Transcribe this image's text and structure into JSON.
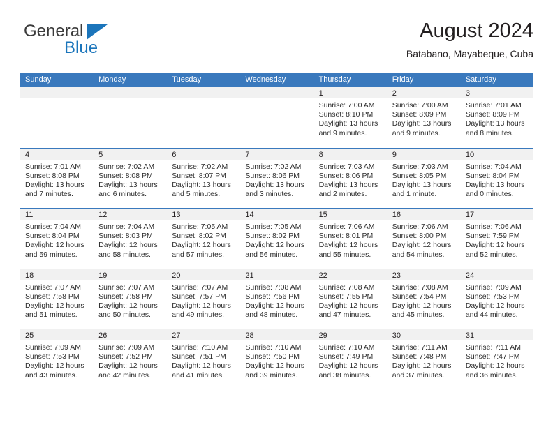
{
  "brand": {
    "line1": "General",
    "line2": "Blue",
    "triangle_color": "#1b75bb"
  },
  "header": {
    "title": "August 2024",
    "subtitle": "Batabano, Mayabeque, Cuba"
  },
  "theme": {
    "header_bar": "#3a79bd",
    "date_strip": "#f1f1f1",
    "text": "#231f20"
  },
  "weekdays": [
    "Sunday",
    "Monday",
    "Tuesday",
    "Wednesday",
    "Thursday",
    "Friday",
    "Saturday"
  ],
  "weeks": [
    [
      {
        "date": "",
        "sunrise": "",
        "sunset": "",
        "daylight": "",
        "empty": true
      },
      {
        "date": "",
        "sunrise": "",
        "sunset": "",
        "daylight": "",
        "empty": true
      },
      {
        "date": "",
        "sunrise": "",
        "sunset": "",
        "daylight": "",
        "empty": true
      },
      {
        "date": "",
        "sunrise": "",
        "sunset": "",
        "daylight": "",
        "empty": true
      },
      {
        "date": "1",
        "sunrise": "Sunrise: 7:00 AM",
        "sunset": "Sunset: 8:10 PM",
        "daylight": "Daylight: 13 hours and 9 minutes."
      },
      {
        "date": "2",
        "sunrise": "Sunrise: 7:00 AM",
        "sunset": "Sunset: 8:09 PM",
        "daylight": "Daylight: 13 hours and 9 minutes."
      },
      {
        "date": "3",
        "sunrise": "Sunrise: 7:01 AM",
        "sunset": "Sunset: 8:09 PM",
        "daylight": "Daylight: 13 hours and 8 minutes."
      }
    ],
    [
      {
        "date": "4",
        "sunrise": "Sunrise: 7:01 AM",
        "sunset": "Sunset: 8:08 PM",
        "daylight": "Daylight: 13 hours and 7 minutes."
      },
      {
        "date": "5",
        "sunrise": "Sunrise: 7:02 AM",
        "sunset": "Sunset: 8:08 PM",
        "daylight": "Daylight: 13 hours and 6 minutes."
      },
      {
        "date": "6",
        "sunrise": "Sunrise: 7:02 AM",
        "sunset": "Sunset: 8:07 PM",
        "daylight": "Daylight: 13 hours and 5 minutes."
      },
      {
        "date": "7",
        "sunrise": "Sunrise: 7:02 AM",
        "sunset": "Sunset: 8:06 PM",
        "daylight": "Daylight: 13 hours and 3 minutes."
      },
      {
        "date": "8",
        "sunrise": "Sunrise: 7:03 AM",
        "sunset": "Sunset: 8:06 PM",
        "daylight": "Daylight: 13 hours and 2 minutes."
      },
      {
        "date": "9",
        "sunrise": "Sunrise: 7:03 AM",
        "sunset": "Sunset: 8:05 PM",
        "daylight": "Daylight: 13 hours and 1 minute."
      },
      {
        "date": "10",
        "sunrise": "Sunrise: 7:04 AM",
        "sunset": "Sunset: 8:04 PM",
        "daylight": "Daylight: 13 hours and 0 minutes."
      }
    ],
    [
      {
        "date": "11",
        "sunrise": "Sunrise: 7:04 AM",
        "sunset": "Sunset: 8:04 PM",
        "daylight": "Daylight: 12 hours and 59 minutes."
      },
      {
        "date": "12",
        "sunrise": "Sunrise: 7:04 AM",
        "sunset": "Sunset: 8:03 PM",
        "daylight": "Daylight: 12 hours and 58 minutes."
      },
      {
        "date": "13",
        "sunrise": "Sunrise: 7:05 AM",
        "sunset": "Sunset: 8:02 PM",
        "daylight": "Daylight: 12 hours and 57 minutes."
      },
      {
        "date": "14",
        "sunrise": "Sunrise: 7:05 AM",
        "sunset": "Sunset: 8:02 PM",
        "daylight": "Daylight: 12 hours and 56 minutes."
      },
      {
        "date": "15",
        "sunrise": "Sunrise: 7:06 AM",
        "sunset": "Sunset: 8:01 PM",
        "daylight": "Daylight: 12 hours and 55 minutes."
      },
      {
        "date": "16",
        "sunrise": "Sunrise: 7:06 AM",
        "sunset": "Sunset: 8:00 PM",
        "daylight": "Daylight: 12 hours and 54 minutes."
      },
      {
        "date": "17",
        "sunrise": "Sunrise: 7:06 AM",
        "sunset": "Sunset: 7:59 PM",
        "daylight": "Daylight: 12 hours and 52 minutes."
      }
    ],
    [
      {
        "date": "18",
        "sunrise": "Sunrise: 7:07 AM",
        "sunset": "Sunset: 7:58 PM",
        "daylight": "Daylight: 12 hours and 51 minutes."
      },
      {
        "date": "19",
        "sunrise": "Sunrise: 7:07 AM",
        "sunset": "Sunset: 7:58 PM",
        "daylight": "Daylight: 12 hours and 50 minutes."
      },
      {
        "date": "20",
        "sunrise": "Sunrise: 7:07 AM",
        "sunset": "Sunset: 7:57 PM",
        "daylight": "Daylight: 12 hours and 49 minutes."
      },
      {
        "date": "21",
        "sunrise": "Sunrise: 7:08 AM",
        "sunset": "Sunset: 7:56 PM",
        "daylight": "Daylight: 12 hours and 48 minutes."
      },
      {
        "date": "22",
        "sunrise": "Sunrise: 7:08 AM",
        "sunset": "Sunset: 7:55 PM",
        "daylight": "Daylight: 12 hours and 47 minutes."
      },
      {
        "date": "23",
        "sunrise": "Sunrise: 7:08 AM",
        "sunset": "Sunset: 7:54 PM",
        "daylight": "Daylight: 12 hours and 45 minutes."
      },
      {
        "date": "24",
        "sunrise": "Sunrise: 7:09 AM",
        "sunset": "Sunset: 7:53 PM",
        "daylight": "Daylight: 12 hours and 44 minutes."
      }
    ],
    [
      {
        "date": "25",
        "sunrise": "Sunrise: 7:09 AM",
        "sunset": "Sunset: 7:53 PM",
        "daylight": "Daylight: 12 hours and 43 minutes."
      },
      {
        "date": "26",
        "sunrise": "Sunrise: 7:09 AM",
        "sunset": "Sunset: 7:52 PM",
        "daylight": "Daylight: 12 hours and 42 minutes."
      },
      {
        "date": "27",
        "sunrise": "Sunrise: 7:10 AM",
        "sunset": "Sunset: 7:51 PM",
        "daylight": "Daylight: 12 hours and 41 minutes."
      },
      {
        "date": "28",
        "sunrise": "Sunrise: 7:10 AM",
        "sunset": "Sunset: 7:50 PM",
        "daylight": "Daylight: 12 hours and 39 minutes."
      },
      {
        "date": "29",
        "sunrise": "Sunrise: 7:10 AM",
        "sunset": "Sunset: 7:49 PM",
        "daylight": "Daylight: 12 hours and 38 minutes."
      },
      {
        "date": "30",
        "sunrise": "Sunrise: 7:11 AM",
        "sunset": "Sunset: 7:48 PM",
        "daylight": "Daylight: 12 hours and 37 minutes."
      },
      {
        "date": "31",
        "sunrise": "Sunrise: 7:11 AM",
        "sunset": "Sunset: 7:47 PM",
        "daylight": "Daylight: 12 hours and 36 minutes."
      }
    ]
  ]
}
